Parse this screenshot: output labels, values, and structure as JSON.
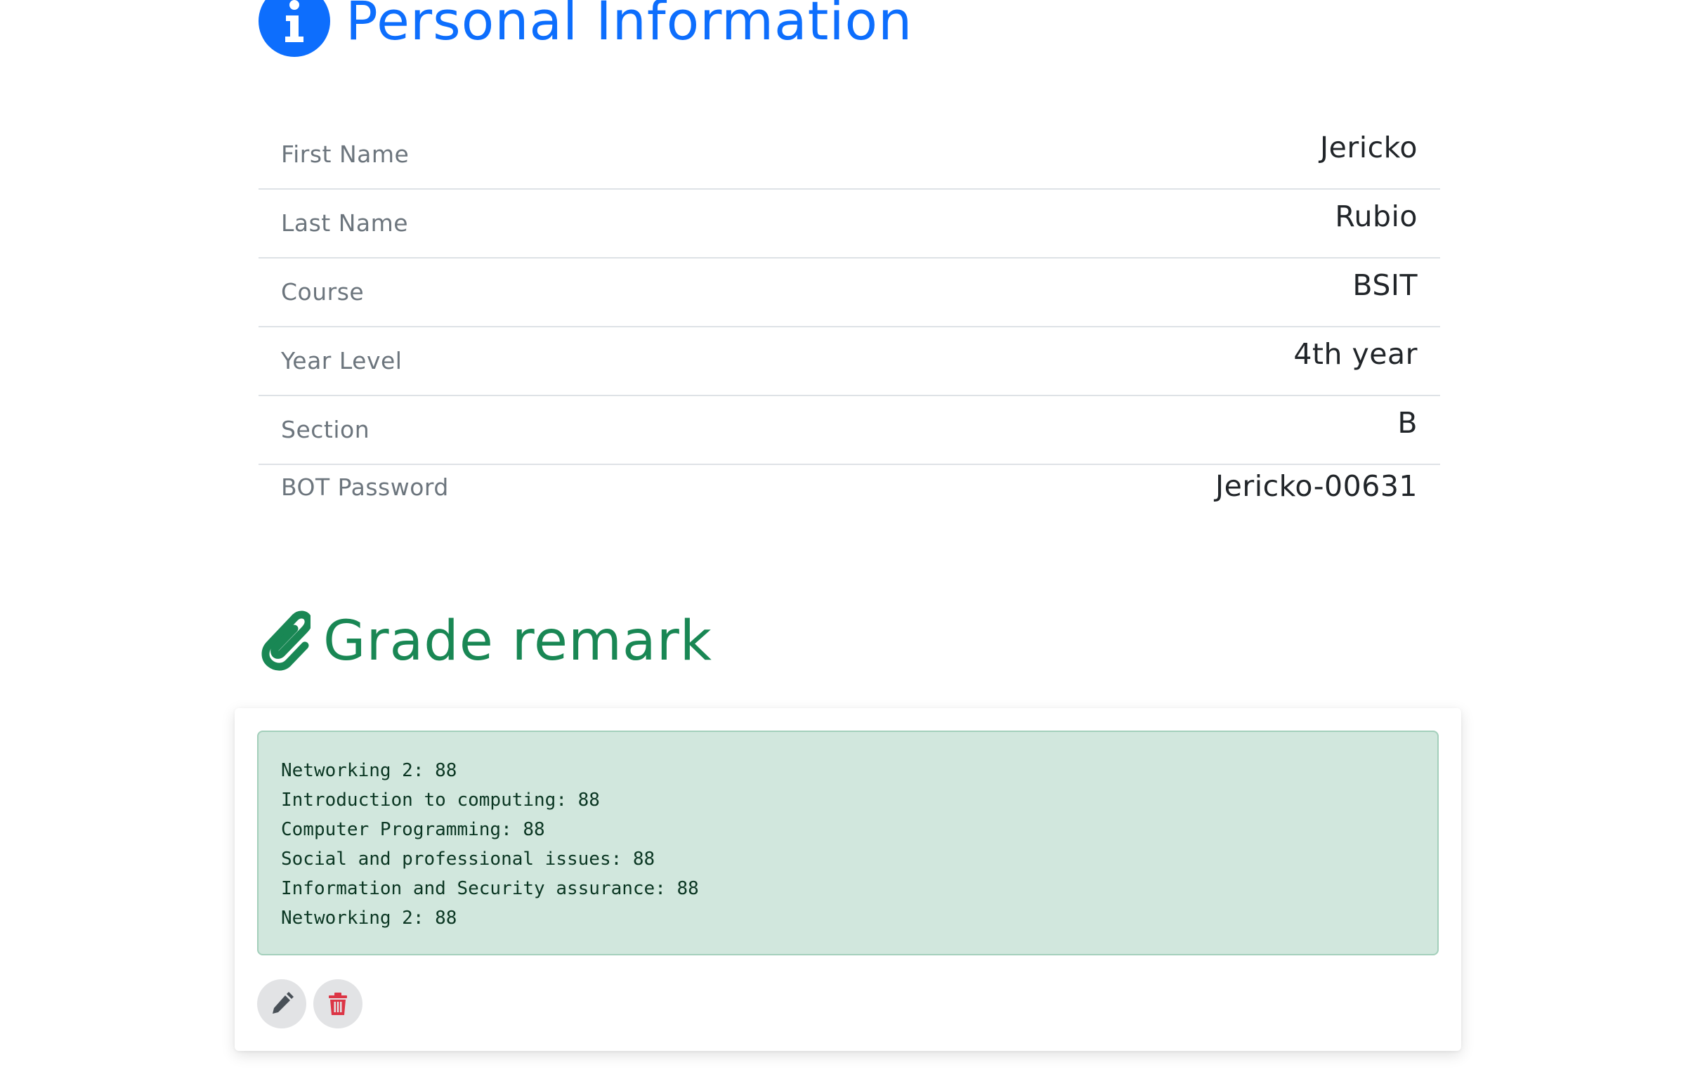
{
  "personal_info": {
    "title": "Personal Information",
    "icon": "info-circle-icon",
    "accent_color": "#0d6efd",
    "rows": [
      {
        "label": "First Name",
        "value": "Jericko"
      },
      {
        "label": "Last Name",
        "value": "Rubio"
      },
      {
        "label": "Course",
        "value": "BSIT"
      },
      {
        "label": "Year Level",
        "value": "4th year"
      },
      {
        "label": "Section",
        "value": "B"
      },
      {
        "label": "BOT Password",
        "value": "Jericko-00631"
      }
    ]
  },
  "grade_remark": {
    "title": "Grade remark",
    "icon": "paperclip-icon",
    "accent_color": "#198754",
    "lines": [
      "Networking 2: 88",
      "Introduction to computing: 88",
      "Computer Programming: 88",
      "Social and professional issues: 88",
      "Information and Security assurance: 88",
      "Networking 2: 88"
    ],
    "actions": [
      {
        "icon": "pencil-icon",
        "color": "#495057"
      },
      {
        "icon": "trash-icon",
        "color": "#dc3545"
      }
    ]
  }
}
